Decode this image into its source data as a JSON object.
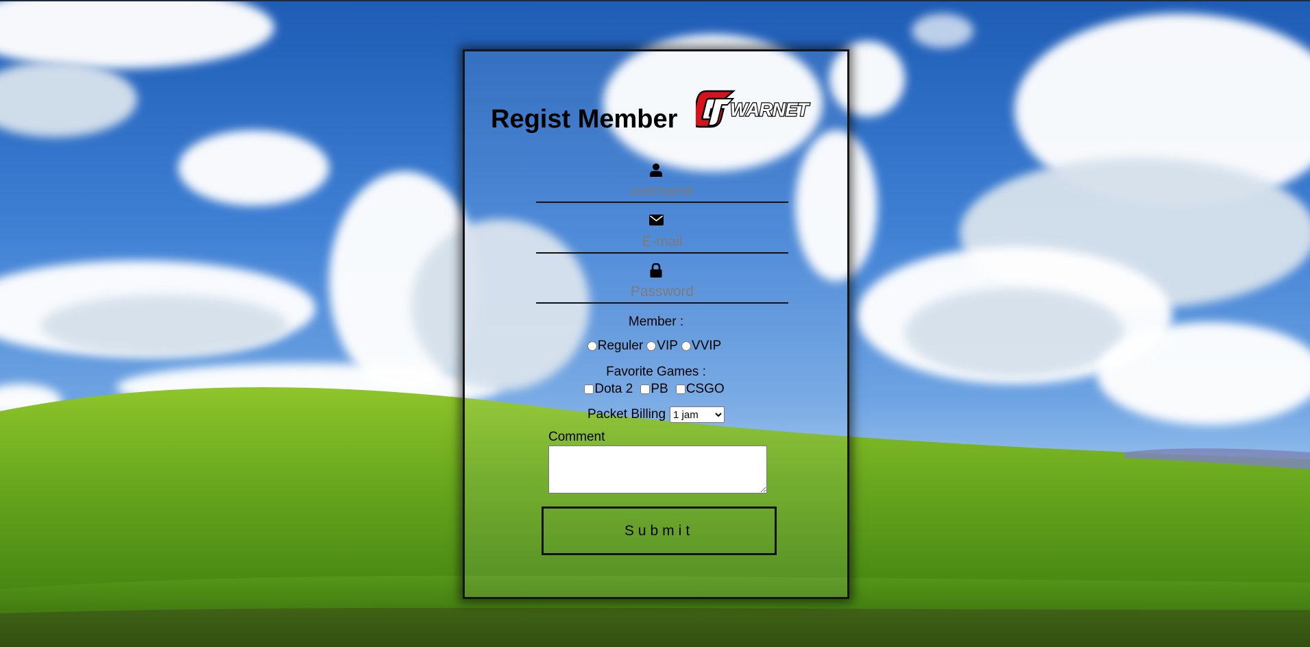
{
  "page": {
    "title": "Regist Member",
    "logo_text": "WARNET"
  },
  "form": {
    "username_placeholder": "username",
    "email_placeholder": "E-mail",
    "password_placeholder": "Password",
    "member_label": "Member :",
    "member_options": [
      "Reguler",
      "VIP",
      "VVIP"
    ],
    "games_label": "Favorite Games :",
    "games_options": [
      "Dota 2",
      "PB",
      "CSGO"
    ],
    "billing_label": "Packet Billing",
    "billing_selected": "1 jam",
    "comment_label": "Comment",
    "submit_label": "Submit"
  },
  "icons": {
    "username": "user-icon",
    "email": "envelope-icon",
    "password": "lock-icon"
  },
  "colors": {
    "logo_red": "#d7121d",
    "text": "#000000",
    "placeholder": "#7b7b7b"
  }
}
